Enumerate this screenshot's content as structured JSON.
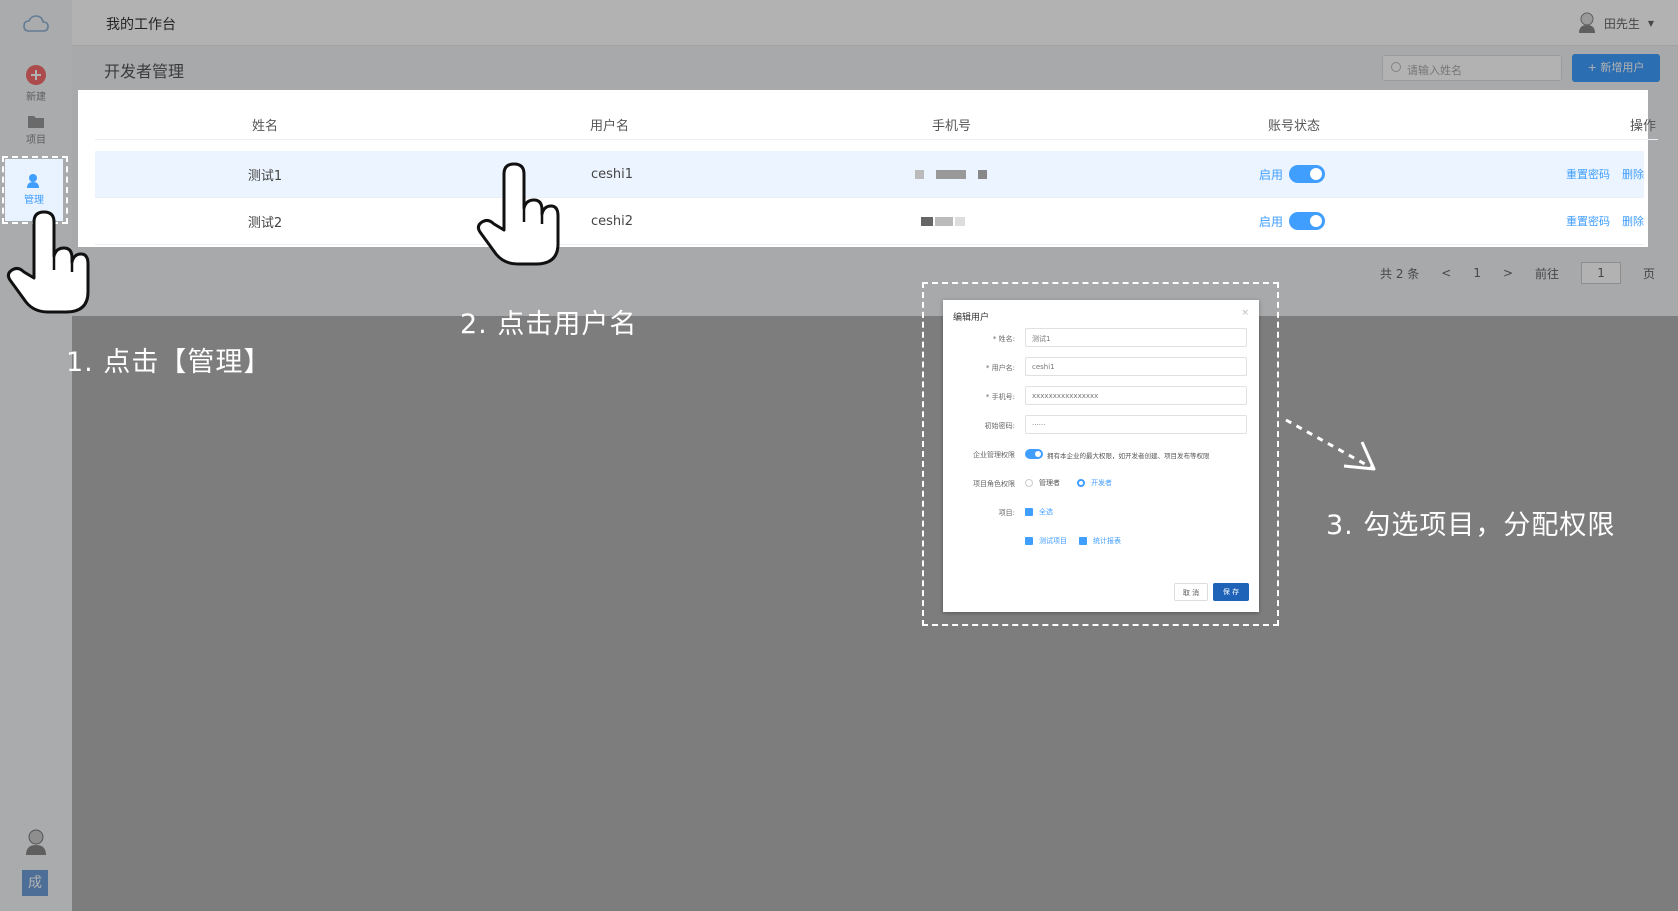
{
  "topbar": {
    "workspace_title": "我的工作台",
    "user_name": "田先生"
  },
  "sidebar": {
    "new_label": "新建",
    "project_label": "项目",
    "manage_label": "管理",
    "bottom_badge": "成"
  },
  "page": {
    "title": "开发者管理",
    "search_placeholder": "请输入姓名",
    "add_button": "+ 新增用户"
  },
  "table": {
    "headers": {
      "name": "姓名",
      "username": "用户名",
      "phone": "手机号",
      "status": "账号状态",
      "ops": "操作"
    },
    "rows": [
      {
        "name": "测试1",
        "username": "ceshi1",
        "status": "启用",
        "reset": "重置密码",
        "delete": "删除"
      },
      {
        "name": "测试2",
        "username": "ceshi2",
        "status": "启用",
        "reset": "重置密码",
        "delete": "删除"
      }
    ]
  },
  "pagination": {
    "total": "共 2 条",
    "prev": "<",
    "page": "1",
    "next": ">",
    "goto": "前往",
    "goto_value": "1",
    "page_unit": "页"
  },
  "annotations": {
    "step1": "1. 点击【管理】",
    "step2": "2. 点击用户名",
    "step3": "3. 勾选项目，分配权限"
  },
  "dialog": {
    "title": "编辑用户",
    "close": "×",
    "name_label": "* 姓名:",
    "name_value": "测试1",
    "username_label": "* 用户名:",
    "username_value": "ceshi1",
    "phone_label": "* 手机号:",
    "phone_value": "xxxxxxxxxxxxxxxx",
    "password_label": "初始密码:",
    "password_value": "······",
    "admin_label": "企业管理权限",
    "admin_desc": "拥有本企业的最大权限，如开发者创建、项目发布等权限",
    "role_label": "项目角色权限",
    "role_manager": "管理者",
    "role_developer": "开发者",
    "project_label": "项目:",
    "select_all": "全选",
    "project_1": "测试项目",
    "project_2": "统计报表",
    "cancel": "取 消",
    "save": "保 存"
  },
  "colors": {
    "accent": "#409eff",
    "save_button": "#1e63b8",
    "overlay": "rgba(0,0,0,0.3)"
  }
}
